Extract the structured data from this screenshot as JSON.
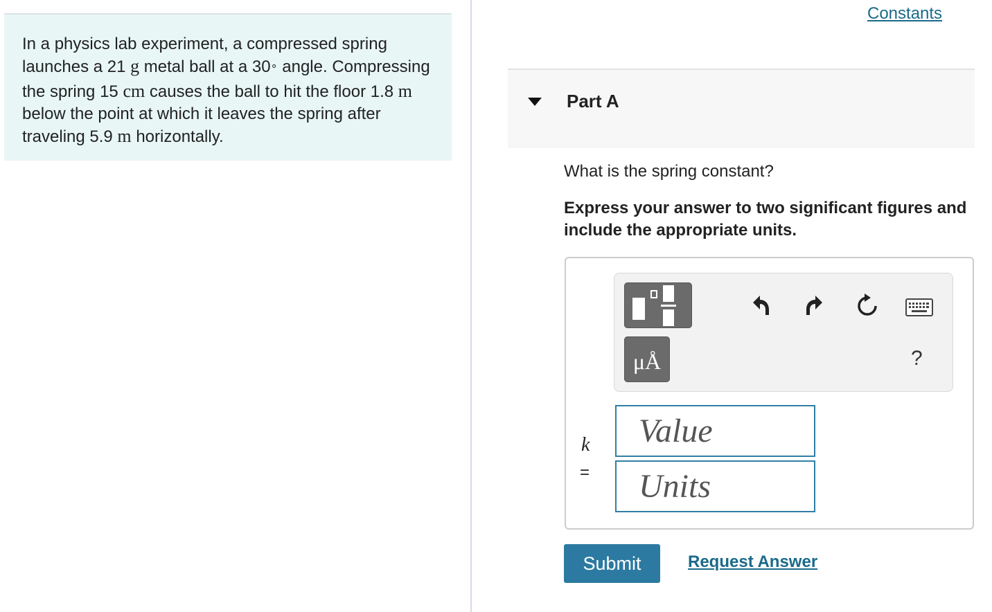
{
  "problem": {
    "t1": "In a physics lab experiment, a compressed spring launches a 21 ",
    "u1": "g",
    "t2": " metal ball at a 30",
    "deg": "∘",
    "t3": " angle. Compressing the spring 15 ",
    "u2": "cm",
    "t4": " causes the ball to hit the floor 1.8 ",
    "u3": "m",
    "t5": " below the point at which it leaves the spring after traveling 5.9 ",
    "u4": "m",
    "t6": " horizontally."
  },
  "header": {
    "constants_link": "Constants"
  },
  "part": {
    "title": "Part A",
    "caret_icon": "caret-down-icon"
  },
  "question": "What is the spring constant?",
  "instruction": "Express your answer to two significant figures and include the appropriate units.",
  "toolbar": {
    "template_icon": "fraction-template-icon",
    "units_label": "μÅ",
    "undo_icon": "undo-icon",
    "redo_icon": "redo-icon",
    "reset_icon": "reset-icon",
    "keyboard_icon": "keyboard-icon",
    "help_label": "?"
  },
  "answer": {
    "variable": "k",
    "equals": "=",
    "value_placeholder": "Value",
    "units_placeholder": "Units"
  },
  "actions": {
    "submit_label": "Submit",
    "request_label": "Request Answer"
  },
  "colors": {
    "problem_bg": "#e8f6f6",
    "accent": "#2c7aa1",
    "link": "#1a6a8a"
  }
}
